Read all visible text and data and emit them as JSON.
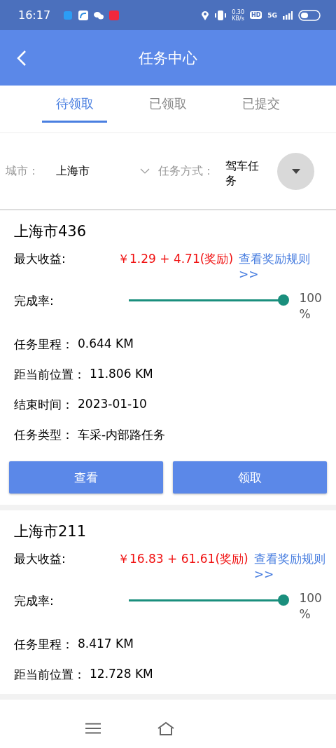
{
  "status_bar": {
    "time": "16:17",
    "speed": "0.30",
    "speed_unit": "KB/s",
    "hd": "HD",
    "network": "5G"
  },
  "header": {
    "title": "任务中心"
  },
  "tabs": [
    {
      "label": "待领取",
      "selected": true
    },
    {
      "label": "已领取",
      "selected": false
    },
    {
      "label": "已提交",
      "selected": false
    }
  ],
  "filters": {
    "city_label": "城市：",
    "city_value": "上海市",
    "mode_label": "任务方式：",
    "mode_value": "驾车任务"
  },
  "tasks": [
    {
      "title": "上海市436",
      "income_label": "最大收益:",
      "income": "￥1.29 + 4.71(奖励)",
      "rules_link": "查看奖励规则>>",
      "completion_label": "完成率:",
      "level": 1.0,
      "reading": "100 %",
      "details": [
        {
          "label": "任务里程：",
          "value": "0.644 KM"
        },
        {
          "label": "距当前位置：",
          "value": "11.806  KM"
        },
        {
          "label": "结束时间：",
          "value": "2023-01-10"
        },
        {
          "label": "任务类型：",
          "value": "车采-内部路任务"
        }
      ],
      "buttons": [
        "查看",
        "领取"
      ]
    },
    {
      "title": "上海市211",
      "income_label": "最大收益:",
      "income": "￥16.83 + 61.61(奖励)",
      "rules_link": "查看奖励规则>>",
      "completion_label": "完成率:",
      "level": 1.0,
      "reading": "100 %",
      "details": [
        {
          "label": "任务里程：",
          "value": "8.417 KM"
        },
        {
          "label": "距当前位置：",
          "value": "12.728  KM"
        }
      ]
    }
  ]
}
